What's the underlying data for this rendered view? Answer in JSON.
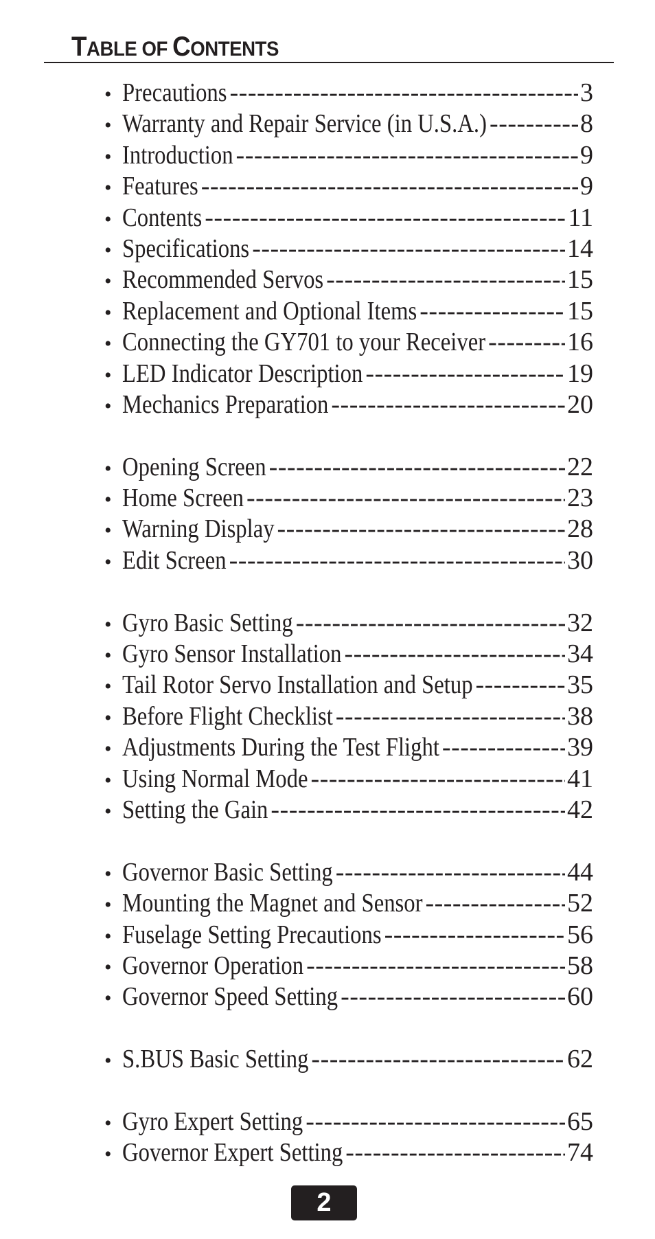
{
  "heading": {
    "first_letter_1": "T",
    "rest_1": "ABLE OF ",
    "first_letter_2": "C",
    "rest_2": "ONTENTS",
    "full": "TABLE OF CONTENTS"
  },
  "bullet": "•",
  "groups": [
    {
      "entries": [
        {
          "title": "Precautions",
          "page": "3"
        },
        {
          "title": "Warranty and Repair Service (in U.S.A.)",
          "page": "8"
        },
        {
          "title": "Introduction",
          "page": "9"
        },
        {
          "title": "Features",
          "page": "9"
        },
        {
          "title": "Contents",
          "page": "11"
        },
        {
          "title": "Specifications",
          "page": "14"
        },
        {
          "title": "Recommended Servos",
          "page": "15"
        },
        {
          "title": "Replacement and Optional Items",
          "page": "15"
        },
        {
          "title": "Connecting the GY701 to your Receiver",
          "page": "16"
        },
        {
          "title": "LED Indicator Description",
          "page": "19"
        },
        {
          "title": "Mechanics Preparation",
          "page": "20"
        }
      ]
    },
    {
      "entries": [
        {
          "title": "Opening Screen",
          "page": "22"
        },
        {
          "title": "Home Screen",
          "page": "23"
        },
        {
          "title": "Warning Display",
          "page": "28"
        },
        {
          "title": "Edit Screen",
          "page": "30"
        }
      ]
    },
    {
      "entries": [
        {
          "title": "Gyro Basic Setting",
          "page": "32"
        },
        {
          "title": "Gyro Sensor Installation",
          "page": "34"
        },
        {
          "title": "Tail Rotor Servo Installation and Setup",
          "page": "35"
        },
        {
          "title": "Before Flight Checklist",
          "page": "38"
        },
        {
          "title": "Adjustments During the Test Flight",
          "page": "39"
        },
        {
          "title": "Using Normal Mode",
          "page": "41"
        },
        {
          "title": "Setting the Gain",
          "page": "42"
        }
      ]
    },
    {
      "entries": [
        {
          "title": "Governor Basic Setting",
          "page": "44"
        },
        {
          "title": "Mounting the Magnet and Sensor",
          "page": "52"
        },
        {
          "title": "Fuselage Setting Precautions",
          "page": "56"
        },
        {
          "title": "Governor Operation",
          "page": "58"
        },
        {
          "title": "Governor Speed Setting",
          "page": "60"
        }
      ]
    },
    {
      "entries": [
        {
          "title": "S.BUS Basic Setting",
          "page": "62"
        }
      ]
    },
    {
      "entries": [
        {
          "title": "Gyro Expert Setting",
          "page": "65"
        },
        {
          "title": "Governor Expert Setting",
          "page": "74"
        }
      ]
    }
  ],
  "footer": {
    "page_number": "2"
  },
  "colors": {
    "text": "#231f20",
    "page_badge_bg": "#231f20",
    "page_badge_text": "#ffffff"
  }
}
